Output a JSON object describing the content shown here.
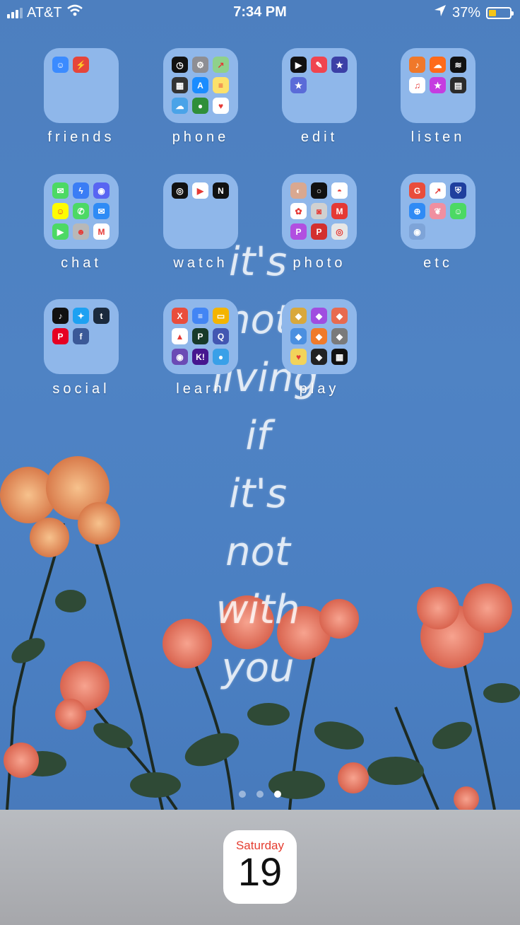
{
  "status": {
    "carrier": "AT&T",
    "time": "7:34 PM",
    "battery": "37%",
    "battery_level": 0.37
  },
  "folders": [
    {
      "label": "friends",
      "apps": [
        {
          "icon": "face-chat-icon",
          "color": "#3b8bff",
          "glyph": "☺"
        },
        {
          "icon": "red-alert-icon",
          "color": "#e6453a",
          "glyph": "⚡"
        }
      ]
    },
    {
      "label": "phone",
      "apps": [
        {
          "icon": "clock-icon",
          "color": "#111111",
          "glyph": "◷"
        },
        {
          "icon": "settings-icon",
          "color": "#8e8e93",
          "glyph": "⚙"
        },
        {
          "icon": "maps-icon",
          "color": "#8fd18a",
          "glyph": "↗"
        },
        {
          "icon": "calculator-icon",
          "color": "#333333",
          "glyph": "▦"
        },
        {
          "icon": "app-store-icon",
          "color": "#1a8cff",
          "glyph": "A"
        },
        {
          "icon": "notes-icon",
          "color": "#fce16b",
          "glyph": "≡"
        },
        {
          "icon": "weather-icon",
          "color": "#4aa3e8",
          "glyph": "☁"
        },
        {
          "icon": "find-my-icon",
          "color": "#2f8f3a",
          "glyph": "●"
        },
        {
          "icon": "health-icon",
          "color": "#ffffff",
          "glyph": "♥"
        }
      ]
    },
    {
      "label": "edit",
      "apps": [
        {
          "icon": "clips-icon",
          "color": "#111111",
          "glyph": "▶"
        },
        {
          "icon": "edit-app-icon",
          "color": "#f0444f",
          "glyph": "✎"
        },
        {
          "icon": "imovie-icon",
          "color": "#3b3fa6",
          "glyph": "★"
        },
        {
          "icon": "star-app-icon",
          "color": "#5a6bd8",
          "glyph": "★"
        }
      ]
    },
    {
      "label": "listen",
      "apps": [
        {
          "icon": "podcast-icon",
          "color": "#f0782a",
          "glyph": "♪"
        },
        {
          "icon": "soundcloud-icon",
          "color": "#ff6a1a",
          "glyph": "☁"
        },
        {
          "icon": "spotify-icon",
          "color": "#111111",
          "glyph": "≋"
        },
        {
          "icon": "music-icon",
          "color": "#ffffff",
          "glyph": "♫"
        },
        {
          "icon": "itunes-store-icon",
          "color": "#c53ce0",
          "glyph": "★"
        },
        {
          "icon": "radio-icon",
          "color": "#2b2b2b",
          "glyph": "▤"
        }
      ]
    },
    {
      "label": "chat",
      "apps": [
        {
          "icon": "messages-icon",
          "color": "#4cd964",
          "glyph": "✉"
        },
        {
          "icon": "messenger-icon",
          "color": "#3a7df5",
          "glyph": "ϟ"
        },
        {
          "icon": "discord-icon",
          "color": "#5865f2",
          "glyph": "◉"
        },
        {
          "icon": "snapchat-icon",
          "color": "#fffc00",
          "glyph": "☺"
        },
        {
          "icon": "phone-icon",
          "color": "#4cd964",
          "glyph": "✆"
        },
        {
          "icon": "mail-icon",
          "color": "#2f8bf5",
          "glyph": "✉"
        },
        {
          "icon": "facetime-icon",
          "color": "#4cd964",
          "glyph": "▶"
        },
        {
          "icon": "contacts-icon",
          "color": "#b8b8b8",
          "glyph": "☻"
        },
        {
          "icon": "gmail-icon",
          "color": "#ffffff",
          "glyph": "M"
        }
      ]
    },
    {
      "label": "watch",
      "apps": [
        {
          "icon": "directv-icon",
          "color": "#111111",
          "glyph": "◎"
        },
        {
          "icon": "youtube-icon",
          "color": "#ffffff",
          "glyph": "▶"
        },
        {
          "icon": "netflix-icon",
          "color": "#111111",
          "glyph": "N"
        }
      ]
    },
    {
      "label": "photo",
      "apps": [
        {
          "icon": "photo-app-icon",
          "color": "#d9a890",
          "glyph": "◐"
        },
        {
          "icon": "camera-ring-icon",
          "color": "#111111",
          "glyph": "○"
        },
        {
          "icon": "photo-editor-icon",
          "color": "#ffffff",
          "glyph": "◓"
        },
        {
          "icon": "photos-icon",
          "color": "#ffffff",
          "glyph": "✿"
        },
        {
          "icon": "camera-icon",
          "color": "#d0d0d0",
          "glyph": "◙"
        },
        {
          "icon": "red-m-icon",
          "color": "#e53935",
          "glyph": "M"
        },
        {
          "icon": "picsart-icon",
          "color": "#b14fe0",
          "glyph": "P"
        },
        {
          "icon": "pixlr-icon",
          "color": "#d32f2f",
          "glyph": "P"
        },
        {
          "icon": "lens-icon",
          "color": "#e6e6e6",
          "glyph": "◎"
        }
      ]
    },
    {
      "label": "etc",
      "apps": [
        {
          "icon": "grubhub-icon",
          "color": "#e94d3c",
          "glyph": "G"
        },
        {
          "icon": "stocks-icon",
          "color": "#ffffff",
          "glyph": "↗"
        },
        {
          "icon": "shield-icon",
          "color": "#1f3f9e",
          "glyph": "⛨"
        },
        {
          "icon": "safari-icon",
          "color": "#2f8bf5",
          "glyph": "⊕"
        },
        {
          "icon": "leaf-icon",
          "color": "#f08fa0",
          "glyph": "❦"
        },
        {
          "icon": "bitmoji-icon",
          "color": "#4cd964",
          "glyph": "☺"
        },
        {
          "icon": "periscope-icon",
          "color": "#7ea4d8",
          "glyph": "◉"
        }
      ]
    },
    {
      "label": "social",
      "apps": [
        {
          "icon": "tiktok-icon",
          "color": "#111111",
          "glyph": "♪"
        },
        {
          "icon": "twitter-icon",
          "color": "#1da1f2",
          "glyph": "✦"
        },
        {
          "icon": "tumblr-icon",
          "color": "#1b2a3d",
          "glyph": "t"
        },
        {
          "icon": "pinterest-icon",
          "color": "#e60023",
          "glyph": "P"
        },
        {
          "icon": "facebook-icon",
          "color": "#3b5998",
          "glyph": "f"
        }
      ]
    },
    {
      "label": "learn",
      "apps": [
        {
          "icon": "flashcard-icon",
          "color": "#e94d3c",
          "glyph": "X"
        },
        {
          "icon": "docs-icon",
          "color": "#4285f4",
          "glyph": "≡"
        },
        {
          "icon": "slides-icon",
          "color": "#f4b400",
          "glyph": "▭"
        },
        {
          "icon": "drive-icon",
          "color": "#ffffff",
          "glyph": "▲"
        },
        {
          "icon": "p-app-icon",
          "color": "#173a2a",
          "glyph": "P"
        },
        {
          "icon": "quizlet-icon",
          "color": "#4257b2",
          "glyph": "Q"
        },
        {
          "icon": "owl-icon",
          "color": "#6b4bb5",
          "glyph": "◉"
        },
        {
          "icon": "kahoot-icon",
          "color": "#46178f",
          "glyph": "K!"
        },
        {
          "icon": "chat-bubble-icon",
          "color": "#39a0e8",
          "glyph": "●"
        }
      ]
    },
    {
      "label": "play",
      "apps": [
        {
          "icon": "game-a-icon",
          "color": "#d9a83c",
          "glyph": "◆"
        },
        {
          "icon": "game-b-icon",
          "color": "#a04de0",
          "glyph": "◆"
        },
        {
          "icon": "game-c-icon",
          "color": "#e86a4f",
          "glyph": "◆"
        },
        {
          "icon": "game-d-icon",
          "color": "#4a8fe0",
          "glyph": "◆"
        },
        {
          "icon": "game-e-icon",
          "color": "#f07a2a",
          "glyph": "◆"
        },
        {
          "icon": "game-f-icon",
          "color": "#7a7a7a",
          "glyph": "◆"
        },
        {
          "icon": "game-g-icon",
          "color": "#f2d35a",
          "glyph": "♥"
        },
        {
          "icon": "game-h-icon",
          "color": "#222222",
          "glyph": "◆"
        },
        {
          "icon": "game-i-icon",
          "color": "#111111",
          "glyph": "▦"
        }
      ]
    }
  ],
  "quote_lines": [
    "it's",
    "not",
    "living",
    "if",
    "it's",
    "not",
    "with",
    "you"
  ],
  "page_dots": {
    "count": 3,
    "active": 2
  },
  "dock": {
    "calendar_day": "Saturday",
    "calendar_date": "19"
  }
}
